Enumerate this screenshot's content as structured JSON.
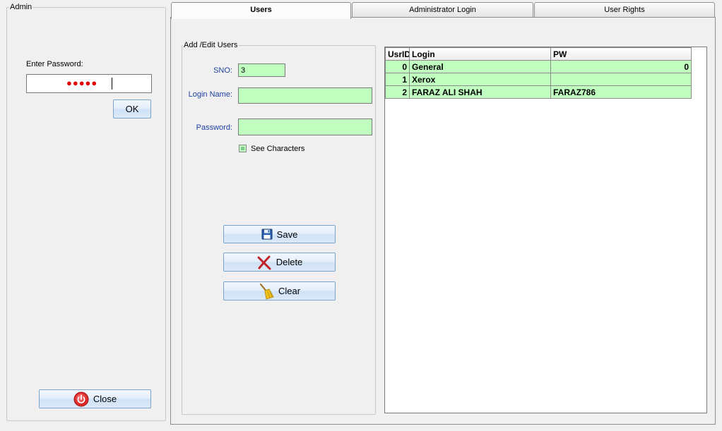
{
  "admin": {
    "group_label": "Admin",
    "password_label": "Enter Password:",
    "password_mask": "●●●●●",
    "ok_label": "OK",
    "close_label": "Close"
  },
  "tabs": [
    {
      "label": "Users",
      "active": true
    },
    {
      "label": "Administrator Login",
      "active": false
    },
    {
      "label": "User Rights",
      "active": false
    }
  ],
  "form": {
    "group_label": "Add /Edit Users",
    "sno_label": "SNO:",
    "sno_value": "3",
    "login_label": "Login Name:",
    "login_value": "",
    "password_label": "Password:",
    "password_value": "",
    "see_chars_label": "See Characters",
    "save_label": "Save",
    "delete_label": "Delete",
    "clear_label": "Clear"
  },
  "grid": {
    "columns": [
      "UsrID",
      "Login",
      "PW"
    ],
    "rows": [
      {
        "id": "0",
        "login": "General",
        "pw": "0"
      },
      {
        "id": "1",
        "login": "Xerox",
        "pw": ""
      },
      {
        "id": "2",
        "login": "FARAZ ALI SHAH",
        "pw": "FARAZ786"
      }
    ]
  },
  "colors": {
    "input_bg": "#c0ffc0",
    "label_blue": "#1f3fa0",
    "button_border": "#7ea3c9",
    "close_icon_red": "#e03030",
    "delete_icon_red": "#c0222a",
    "save_icon_blue": "#2a5fb0"
  }
}
